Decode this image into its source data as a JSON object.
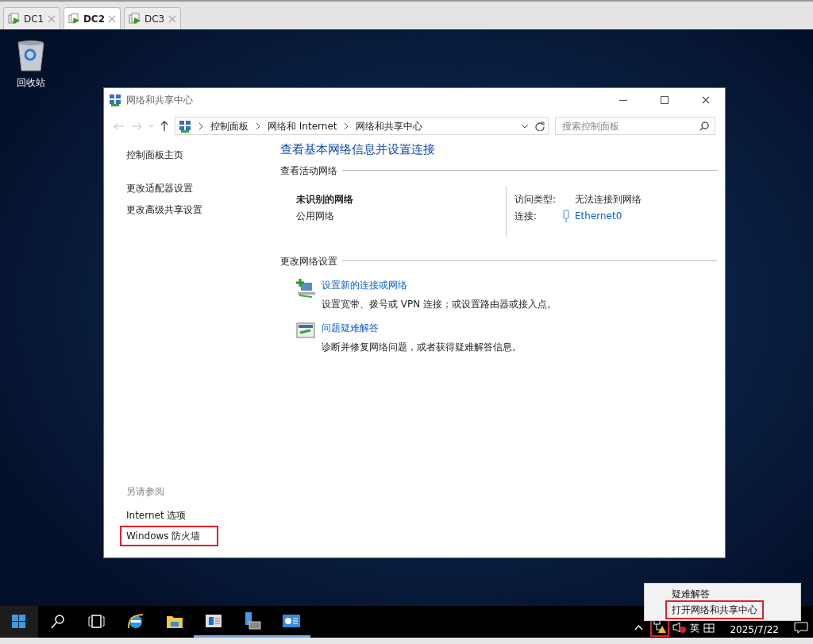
{
  "vm_tabs": [
    {
      "label": "DC1",
      "selected": false
    },
    {
      "label": "DC2",
      "selected": true
    },
    {
      "label": "DC3",
      "selected": false
    }
  ],
  "desktop_icons": [
    {
      "label": "回收站"
    }
  ],
  "window": {
    "title": "网络和共享中心",
    "breadcrumb": [
      "控制面板",
      "网络和 Internet",
      "网络和共享中心"
    ],
    "search": {
      "placeholder": "搜索控制面板"
    },
    "sidebar": {
      "links": [
        {
          "label": "控制面板主页"
        },
        {
          "label": "更改适配器设置"
        },
        {
          "label": "更改高级共享设置"
        }
      ],
      "see_also_heading": "另请参阅",
      "see_also": [
        {
          "label": "Internet 选项",
          "highlighted": false
        },
        {
          "label": "Windows 防火墙",
          "highlighted": true
        }
      ]
    },
    "heading": "查看基本网络信息并设置连接",
    "active_networks": {
      "heading": "查看活动网络",
      "name": "未识别的网络",
      "type": "公用网络",
      "access_label": "访问类型:",
      "access_value": "无法连接到网络",
      "connections_label": "连接:",
      "connection": "Ethernet0"
    },
    "change_settings": {
      "heading": "更改网络设置",
      "tasks": [
        {
          "kind": "new-connection",
          "title": "设置新的连接或网络",
          "description": "设置宽带、拨号或 VPN 连接；或设置路由器或接入点。"
        },
        {
          "kind": "troubleshoot",
          "title": "问题疑难解答",
          "description": "诊断并修复网络问题，或者获得疑难解答信息。"
        }
      ]
    }
  },
  "taskbar": {
    "buttons": [
      {
        "kind": "start",
        "running": false
      },
      {
        "kind": "search",
        "running": false
      },
      {
        "kind": "task-view",
        "running": false
      },
      {
        "kind": "browser",
        "running": false
      },
      {
        "kind": "folder",
        "running": false
      },
      {
        "kind": "manager",
        "running": true
      },
      {
        "kind": "server",
        "running": true
      },
      {
        "kind": "panel",
        "running": true
      }
    ],
    "tray": {
      "network_highlighted": true,
      "ime": "英",
      "date": "2025/7/22"
    }
  },
  "context_menu": {
    "items": [
      {
        "label": "疑难解答",
        "highlighted": false
      },
      {
        "label": "打开网络和共享中心",
        "highlighted": true
      }
    ]
  }
}
